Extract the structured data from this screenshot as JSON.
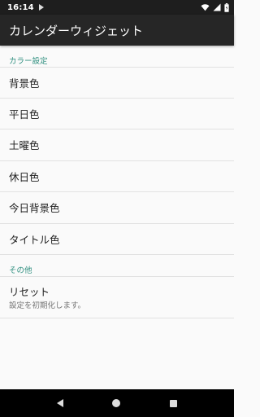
{
  "status_bar": {
    "time": "16:14",
    "icons": [
      "play-store-icon",
      "wifi-icon",
      "signal-icon",
      "battery-icon"
    ]
  },
  "app_bar": {
    "title": "カレンダーウィジェット"
  },
  "sections": [
    {
      "header": "カラー設定",
      "items": [
        "背景色",
        "平日色",
        "土曜色",
        "休日色",
        "今日背景色",
        "タイトル色"
      ]
    },
    {
      "header": "その他",
      "items": [
        {
          "title": "リセット",
          "summary": "設定を初期化します。"
        }
      ]
    }
  ],
  "colors": {
    "status_bar": "#1e1e1e",
    "app_bar": "#262626",
    "accent": "#2f8f7f",
    "background": "#fafafa"
  }
}
